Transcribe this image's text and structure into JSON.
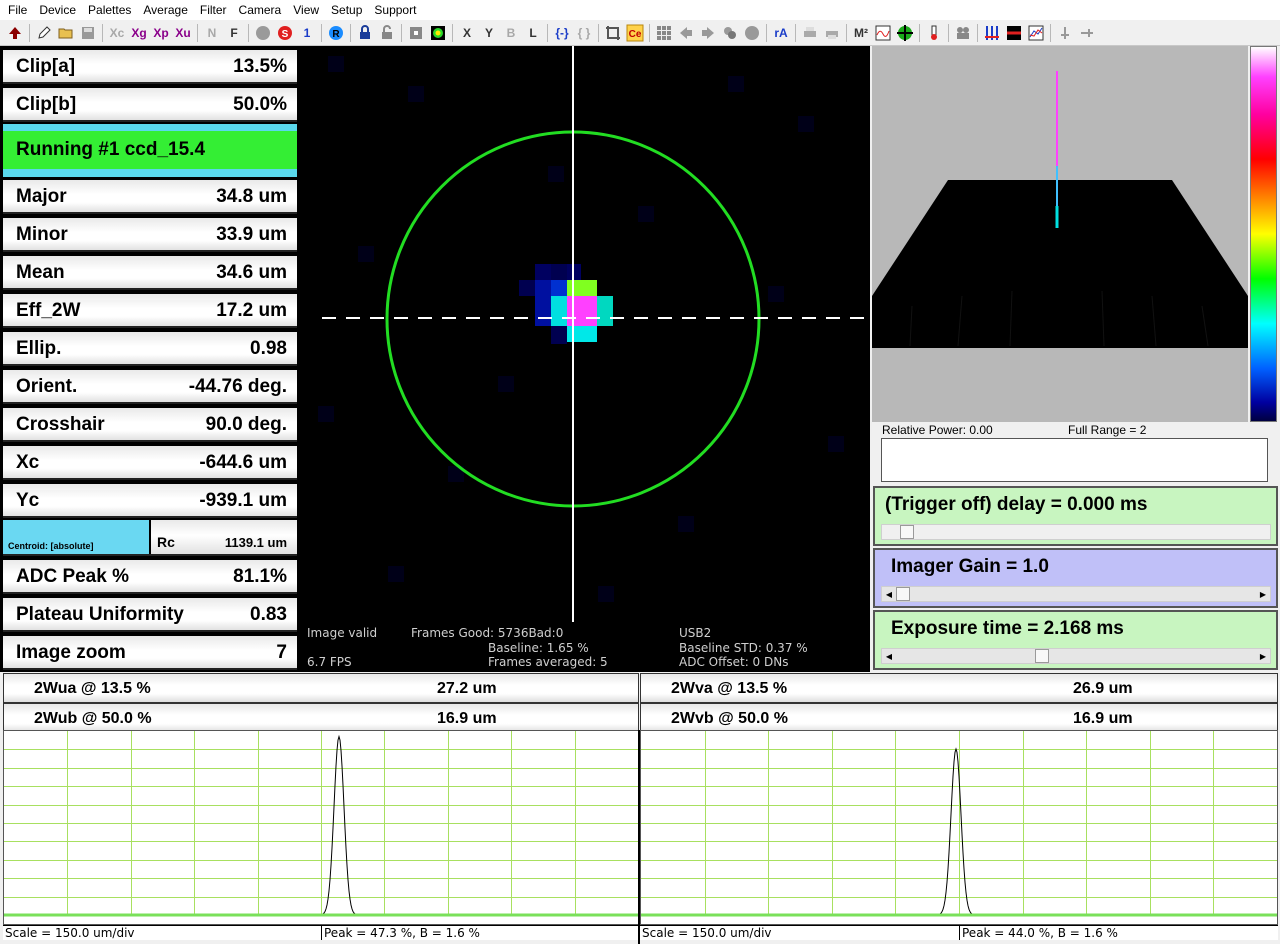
{
  "menu": [
    "File",
    "Device",
    "Palettes",
    "Average",
    "Filter",
    "Camera",
    "View",
    "Setup",
    "Support"
  ],
  "toolbar": {
    "icons": [
      "up-arrow-icon",
      "pencil-icon",
      "open-folder-icon",
      "save-icon",
      "xc-icon",
      "xg-icon",
      "xp-icon",
      "xu-icon",
      "n-icon",
      "f-icon",
      "gray-circle-icon",
      "s-circle-icon",
      "one-icon",
      "r-circle-icon",
      "lock-icon",
      "unlock-icon",
      "square-icon",
      "target-color-icon",
      "x-axis-icon",
      "y-axis-icon",
      "b-icon",
      "l-icon",
      "bracket-blue-icon",
      "bracket-gray-icon",
      "crop-icon",
      "ce-icon",
      "grid-icon",
      "arrow-left-icon",
      "arrow-right-icon",
      "stack-icon",
      "gray-dot-icon",
      "ra-icon",
      "print-icon",
      "print2-icon",
      "m2-icon",
      "chart-icon",
      "crosshair-icon",
      "thermo-icon",
      "reel-icon",
      "bars-icon",
      "line-red-icon",
      "graph-icon",
      "pin-icon",
      "arrow-pin-icon"
    ],
    "labels": {
      "xc": "Xc",
      "xg": "Xg",
      "xp": "Xp",
      "xu": "Xu",
      "n": "N",
      "f": "F",
      "s": "S",
      "one": "1",
      "r": "R",
      "x": "X",
      "y": "Y",
      "b": "B",
      "l": "L",
      "br1": "{-}",
      "br2": "{ }",
      "ce": "Ce",
      "ra": "rA",
      "m2": "M²"
    }
  },
  "left_panel": {
    "clip_a": {
      "label": "Clip[a]",
      "value": "13.5%"
    },
    "clip_b": {
      "label": "Clip[b]",
      "value": "50.0%"
    },
    "status": "Running #1 ccd_15.4",
    "rows": [
      {
        "label": "Major",
        "value": "34.8 um"
      },
      {
        "label": "Minor",
        "value": "33.9 um"
      },
      {
        "label": "Mean",
        "value": "34.6 um"
      },
      {
        "label": "Eff_2W",
        "value": "17.2 um"
      },
      {
        "label": "Ellip.",
        "value": "0.98"
      },
      {
        "label": "Orient.",
        "value": "-44.76 deg."
      },
      {
        "label": "Crosshair",
        "value": "90.0 deg."
      },
      {
        "label": "Xc",
        "value": "-644.6 um"
      },
      {
        "label": "Yc",
        "value": "-939.1 um"
      }
    ],
    "centroid_mode": "Centroid: [absolute]",
    "rc": {
      "label": "Rc",
      "value": "1139.1 um"
    },
    "rows2": [
      {
        "label": "ADC Peak %",
        "value": "81.1%"
      },
      {
        "label": "Plateau Uniformity",
        "value": "0.83"
      },
      {
        "label": "Image zoom",
        "value": "7"
      }
    ]
  },
  "image_view": {
    "image_valid": "Image valid",
    "fps": "6.7 FPS",
    "frames_good": "Frames Good: 5736Bad:0",
    "baseline": "Baseline: 1.65 %",
    "frames_averaged": "Frames averaged: 5",
    "usb": "USB2",
    "baseline_std": "Baseline STD:  0.37 %",
    "adc_offset": "ADC Offset: 0 DNs"
  },
  "view3d": {
    "relative_power": "Relative Power: 0.00",
    "full_range": "Full Range = 2"
  },
  "controls": {
    "trigger": "(Trigger off) delay = 0.000 ms",
    "gain": "Imager Gain = 1.0",
    "exposure": "Exposure time = 2.168 ms",
    "trigger_level": 0.0,
    "gain_level": 0.0,
    "exposure_level": 0.4
  },
  "widths": {
    "wua": {
      "label": "2Wua @ 13.5 %",
      "value": "27.2 um"
    },
    "wub": {
      "label": "2Wub @ 50.0 %",
      "value": "16.9 um"
    },
    "wva": {
      "label": "2Wva @ 13.5 %",
      "value": "26.9 um"
    },
    "wvb": {
      "label": "2Wvb @ 50.0 %",
      "value": "16.9 um"
    }
  },
  "profiles": {
    "u": {
      "scale": "Scale = 150.0 um/div",
      "peak": "Peak = 47.3 %,  B = 1.6 %",
      "peak_fraction": 0.473
    },
    "v": {
      "scale": "Scale = 150.0 um/div",
      "peak": "Peak = 44.0 %,  B = 1.6 %",
      "peak_fraction": 0.44
    }
  },
  "colors": {
    "green_status": "#34ee34",
    "cyan": "#5ad8ec",
    "grid_green": "#a8e060",
    "ellipse_green": "#22dd22"
  }
}
